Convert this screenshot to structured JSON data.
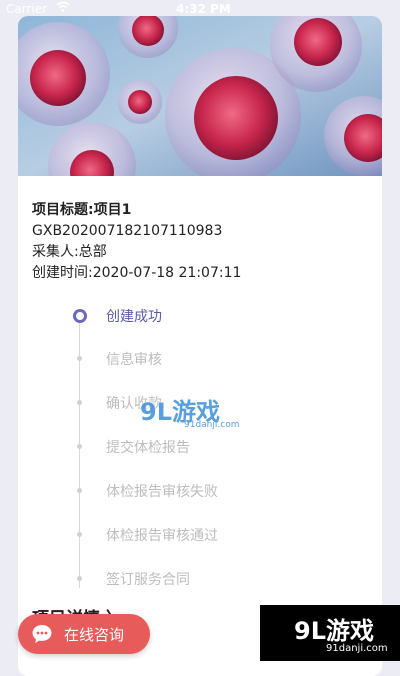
{
  "status_bar": {
    "carrier": "Carrier",
    "time": "4:32 PM"
  },
  "project": {
    "title": "项目标题:项目1",
    "code": "GXB202007182107110983",
    "collector": "采集人:总部",
    "created": "创建时间:2020-07-18 21:07:11"
  },
  "timeline": [
    {
      "label": "创建成功",
      "active": true
    },
    {
      "label": "信息审核",
      "active": false
    },
    {
      "label": "确认收款",
      "active": false
    },
    {
      "label": "提交体检报告",
      "active": false
    },
    {
      "label": "体检报告审核失败",
      "active": false
    },
    {
      "label": "体检报告审核通过",
      "active": false
    },
    {
      "label": "签订服务合同",
      "active": false
    }
  ],
  "section": {
    "details_title": "项目详情 〉"
  },
  "chat": {
    "label": "在线咨询"
  },
  "watermark": {
    "brand": "9L游戏",
    "site": "91danji.com",
    "corner_brand": "9L游戏",
    "corner_site": "91danji.com"
  },
  "colors": {
    "accent": "#5b5ba8",
    "chat": "#e85b5b",
    "inactive": "#bdbdbd"
  },
  "icons": {
    "wifi": "wifi-icon",
    "chat": "chat-bubble-icon"
  }
}
